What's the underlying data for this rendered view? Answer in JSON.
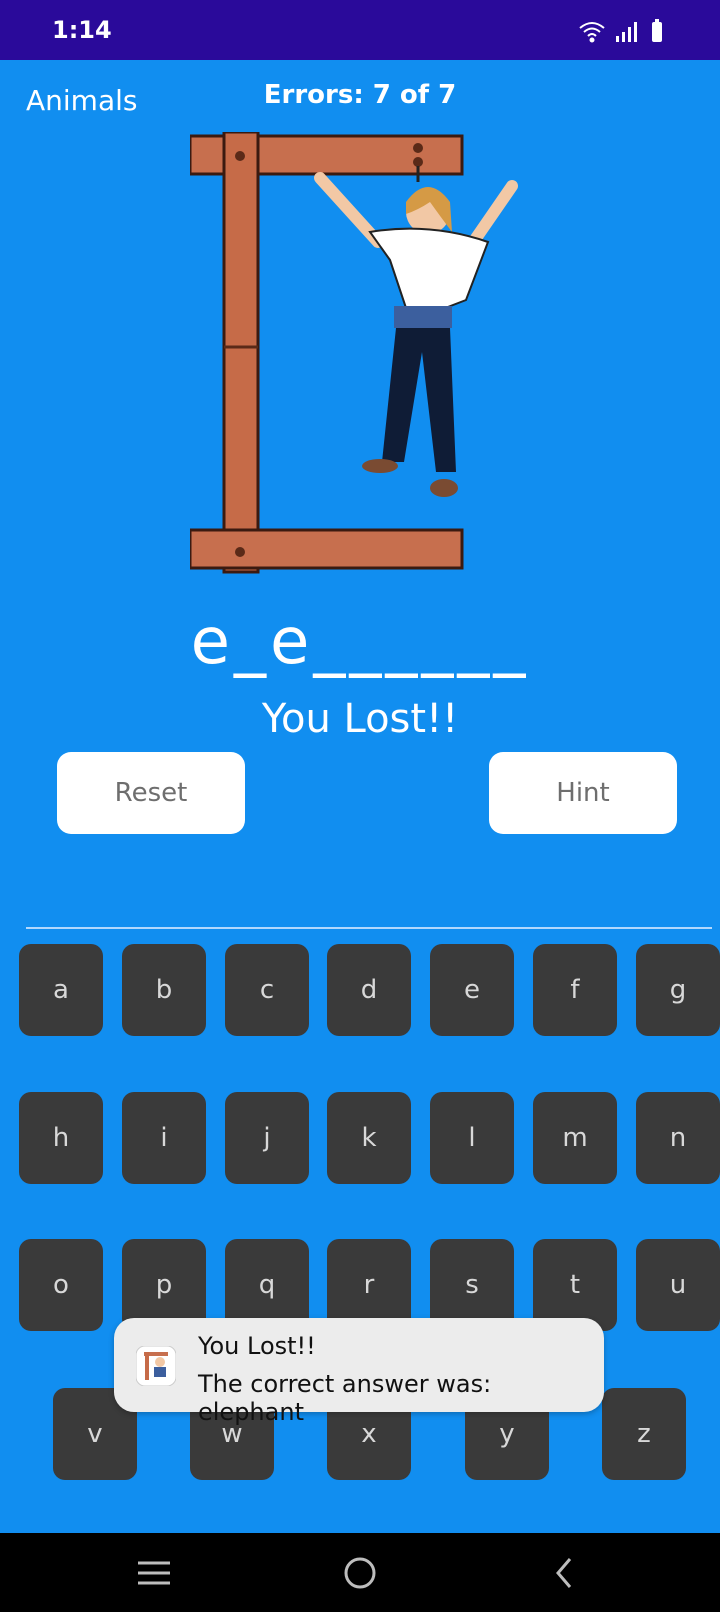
{
  "status_bar": {
    "time": "1:14",
    "icons": [
      "wifi-icon",
      "signal-icon",
      "battery-icon"
    ]
  },
  "header": {
    "category": "Animals",
    "errors": "Errors: 7 of 7"
  },
  "game": {
    "word_display": "e_e______",
    "result_text": "You Lost!!"
  },
  "buttons": {
    "reset": "Reset",
    "hint": "Hint"
  },
  "keyboard": {
    "row1": [
      "a",
      "b",
      "c",
      "d",
      "e",
      "f",
      "g"
    ],
    "row2": [
      "h",
      "i",
      "j",
      "k",
      "l",
      "m",
      "n"
    ],
    "row3": [
      "o",
      "p",
      "q",
      "r",
      "s",
      "t",
      "u"
    ],
    "row4": [
      "v",
      "w",
      "x",
      "y",
      "z"
    ]
  },
  "toast": {
    "title": "You Lost!!",
    "message": "The correct answer was: elephant"
  },
  "nav_bar": {
    "icons": [
      "menu-icon",
      "home-icon",
      "back-icon"
    ]
  },
  "colors": {
    "background": "#118ef0",
    "status_bar": "#2a0a9a",
    "key": "#3a3a3a",
    "toast": "#ececec"
  }
}
